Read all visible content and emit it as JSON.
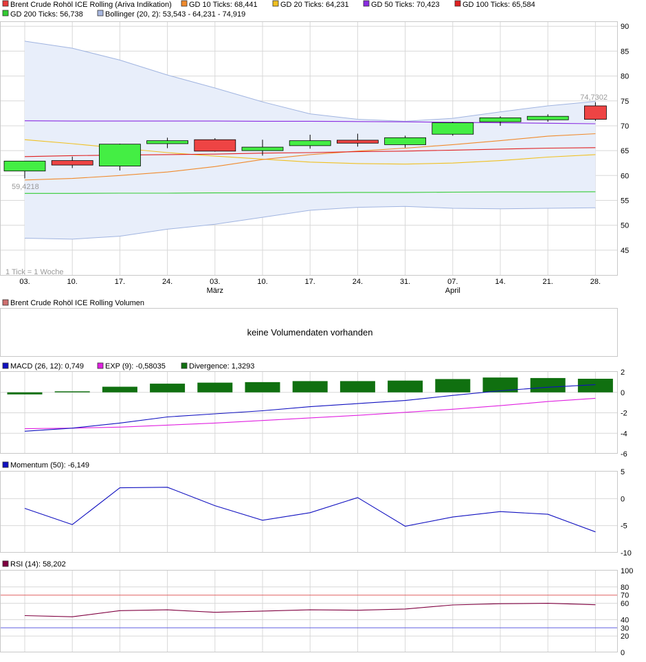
{
  "legends": {
    "main": [
      {
        "label": "Brent Crude Rohöl ICE Rolling (Ariva Indikation)",
        "color": "#e83b3b"
      },
      {
        "label": "GD 10 Ticks: 68,441",
        "color": "#f08a2c"
      },
      {
        "label": "GD 20 Ticks: 64,231",
        "color": "#f0c020"
      },
      {
        "label": "GD 50 Ticks: 70,423",
        "color": "#8a2be2"
      },
      {
        "label": "GD 100 Ticks: 65,584",
        "color": "#e02020"
      },
      {
        "label": "GD 200 Ticks: 56,738",
        "color": "#33cc33"
      },
      {
        "label": "Bollinger (20, 2): 53,543 - 64,231 - 74,919",
        "color": "#a8b8e0"
      }
    ],
    "volume": {
      "label": "Brent Crude Rohöl ICE Rolling Volumen",
      "color": "#d07070"
    },
    "macd": [
      {
        "label": "MACD (26, 12): 0,749",
        "color": "#1010c0"
      },
      {
        "label": "EXP (9): -0,58035",
        "color": "#e020e0"
      },
      {
        "label": "Divergence: 1,3293",
        "color": "#107010"
      }
    ],
    "momentum": {
      "label": "Momentum (50): -6,149",
      "color": "#1010c0"
    },
    "rsi": {
      "label": "RSI (14): 58,202",
      "color": "#800040"
    }
  },
  "notes": {
    "tick_info": "1 Tick = 1 Woche",
    "no_volume": "keine Volumendaten vorhanden",
    "max_label": "74,7302",
    "min_label": "59,4218"
  },
  "colors": {
    "up": "#44ee44",
    "down": "#ee4444",
    "grid": "#d8d8d8",
    "band_fill": "#e8eefa",
    "band_line": "#a0b4e0",
    "divergence": "#107010"
  },
  "chart_data": [
    {
      "type": "candlestick",
      "title": "Brent Crude Rohöl ICE Rolling (Ariva Indikation)",
      "x_ticks": [
        "03.",
        "10.",
        "17.",
        "24.",
        "03.",
        "10.",
        "17.",
        "24.",
        "31.",
        "07.",
        "14.",
        "21.",
        "28."
      ],
      "month_labels": [
        {
          "text": "März",
          "at": 4
        },
        {
          "text": "April",
          "at": 9
        }
      ],
      "ylim": [
        40,
        91
      ],
      "y_ticks": [
        45,
        50,
        55,
        60,
        65,
        70,
        75,
        80,
        85,
        90
      ],
      "grid": true,
      "candles": [
        {
          "open": 60.9,
          "high": 62.8,
          "low": 59.42,
          "close": 62.9
        },
        {
          "open": 63.0,
          "high": 63.8,
          "low": 61.5,
          "close": 62.1
        },
        {
          "open": 61.9,
          "high": 66.4,
          "low": 61.0,
          "close": 66.3
        },
        {
          "open": 66.4,
          "high": 67.6,
          "low": 65.5,
          "close": 67.0
        },
        {
          "open": 67.2,
          "high": 67.5,
          "low": 64.8,
          "close": 64.9
        },
        {
          "open": 65.0,
          "high": 67.2,
          "low": 64.0,
          "close": 65.7
        },
        {
          "open": 66.0,
          "high": 68.2,
          "low": 65.4,
          "close": 67.0
        },
        {
          "open": 67.1,
          "high": 68.4,
          "low": 65.8,
          "close": 66.5
        },
        {
          "open": 66.2,
          "high": 68.0,
          "low": 65.6,
          "close": 67.6
        },
        {
          "open": 68.3,
          "high": 70.8,
          "low": 68.0,
          "close": 70.6
        },
        {
          "open": 70.8,
          "high": 71.9,
          "low": 70.0,
          "close": 71.6
        },
        {
          "open": 71.2,
          "high": 72.3,
          "low": 70.8,
          "close": 71.9
        },
        {
          "open": 74.0,
          "high": 74.73,
          "low": 71.0,
          "close": 71.3
        }
      ],
      "series": [
        {
          "name": "GD 10 Ticks",
          "values": [
            59.1,
            59.4,
            60.0,
            60.7,
            61.8,
            63.2,
            64.2,
            64.9,
            65.5,
            66.2,
            67.0,
            67.9,
            68.4
          ]
        },
        {
          "name": "GD 20 Ticks",
          "values": [
            67.2,
            66.4,
            65.5,
            64.6,
            63.9,
            63.3,
            62.7,
            62.4,
            62.3,
            62.5,
            63.0,
            63.7,
            64.2
          ]
        },
        {
          "name": "GD 50 Ticks",
          "values": [
            71.0,
            70.95,
            70.95,
            70.95,
            70.95,
            70.9,
            70.9,
            70.85,
            70.8,
            70.7,
            70.6,
            70.5,
            70.4
          ]
        },
        {
          "name": "GD 100 Ticks",
          "values": [
            63.8,
            64.0,
            64.1,
            64.2,
            64.3,
            64.5,
            64.6,
            64.8,
            64.9,
            65.1,
            65.3,
            65.5,
            65.6
          ]
        },
        {
          "name": "GD 200 Ticks",
          "values": [
            56.4,
            56.4,
            56.45,
            56.45,
            56.5,
            56.5,
            56.55,
            56.6,
            56.6,
            56.65,
            56.7,
            56.7,
            56.74
          ]
        },
        {
          "name": "Bollinger upper",
          "values": [
            87.0,
            85.6,
            83.2,
            80.2,
            77.6,
            74.8,
            72.4,
            71.3,
            70.9,
            71.5,
            72.8,
            74.0,
            74.9
          ]
        },
        {
          "name": "Bollinger lower",
          "values": [
            47.4,
            47.2,
            47.8,
            49.2,
            50.2,
            51.6,
            53.0,
            53.6,
            53.8,
            53.4,
            53.3,
            53.4,
            53.5
          ]
        }
      ]
    },
    {
      "type": "bar",
      "title": "MACD (26, 12)",
      "ylim": [
        -6,
        2
      ],
      "y_ticks": [
        2,
        0,
        -2,
        -4,
        -6
      ],
      "grid": true,
      "divergence": [
        -0.2,
        0.1,
        0.55,
        0.85,
        0.95,
        1.0,
        1.1,
        1.1,
        1.15,
        1.3,
        1.45,
        1.4,
        1.33
      ],
      "series": [
        {
          "name": "MACD (26, 12)",
          "values": [
            -3.8,
            -3.5,
            -3.0,
            -2.4,
            -2.1,
            -1.8,
            -1.4,
            -1.1,
            -0.8,
            -0.3,
            0.15,
            0.5,
            0.75
          ]
        },
        {
          "name": "EXP (9)",
          "values": [
            -3.55,
            -3.5,
            -3.4,
            -3.2,
            -3.0,
            -2.75,
            -2.5,
            -2.25,
            -1.95,
            -1.65,
            -1.3,
            -0.9,
            -0.58
          ]
        }
      ]
    },
    {
      "type": "line",
      "title": "Momentum (50)",
      "ylim": [
        -10,
        5
      ],
      "y_ticks": [
        5,
        0,
        -5,
        -10
      ],
      "grid": true,
      "series": [
        {
          "name": "Momentum (50)",
          "values": [
            -1.8,
            -4.8,
            2.0,
            2.1,
            -1.3,
            -4.0,
            -2.6,
            0.2,
            -5.1,
            -3.4,
            -2.4,
            -2.9,
            -6.15
          ]
        }
      ]
    },
    {
      "type": "line",
      "title": "RSI (14)",
      "ylim": [
        0,
        100
      ],
      "y_ticks": [
        100,
        80,
        60,
        40,
        20,
        0
      ],
      "reference_lines": [
        70,
        30
      ],
      "reference_labels": [
        "70",
        "30"
      ],
      "grid": true,
      "series": [
        {
          "name": "RSI (14)",
          "values": [
            45,
            43.5,
            51,
            52,
            49,
            50.5,
            52,
            51.5,
            53,
            58,
            59.5,
            60,
            58.2
          ]
        }
      ]
    }
  ]
}
